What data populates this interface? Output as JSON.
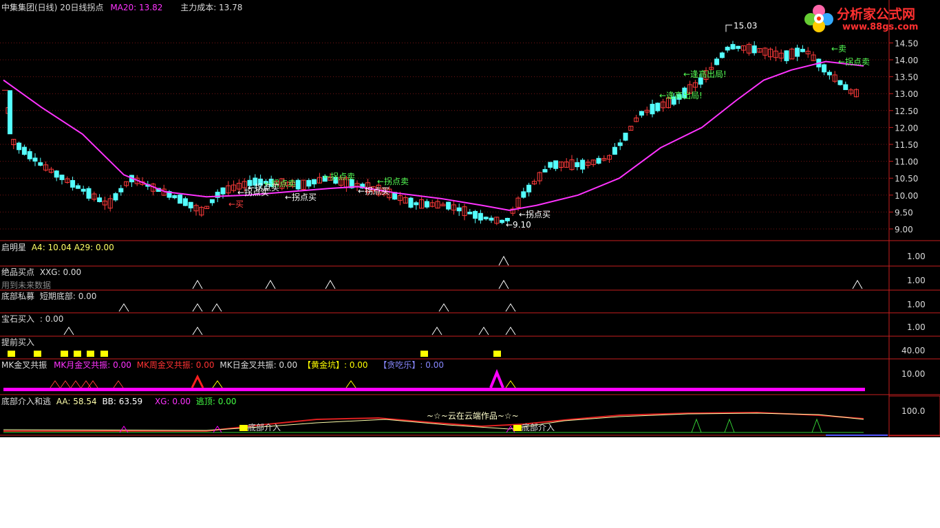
{
  "colors": {
    "bg": "#000000",
    "up": "#ff3b3b",
    "down": "#54ffff",
    "ma": "#ff33ff",
    "buy": "#ff4040",
    "sell": "#55ff55",
    "text": "#dcdcdc",
    "axis": "#c81e1e",
    "yellow": "#ffff00",
    "magenta": "#ff00ff",
    "green": "#33cc33"
  },
  "main": {
    "title": "中集集团(日线)",
    "indicator": "20日线拐点",
    "ma_label": "MA20: 13.82",
    "cost_label": "主力成本: 13.78",
    "yaxis": [
      "14.50",
      "14.00",
      "13.50",
      "13.00",
      "12.50",
      "12.00",
      "11.50",
      "11.00",
      "10.50",
      "10.00",
      "9.50",
      "9.00"
    ],
    "high_label": "15.03",
    "low_label": "9.10",
    "annotations": [
      {
        "text": "←卖",
        "type": "sell"
      },
      {
        "text": "←买",
        "type": "buy"
      },
      {
        "text": "←拐点卖",
        "type": "sell"
      },
      {
        "text": "←拐点买",
        "type": "text"
      },
      {
        "text": "←拐点卖",
        "type": "sell"
      },
      {
        "text": "←拐点买",
        "type": "text"
      },
      {
        "text": "←拐点买",
        "type": "text"
      },
      {
        "text": "←拐点卖",
        "type": "sell"
      },
      {
        "text": "←拐点买",
        "type": "text"
      },
      {
        "text": "←拐点卖",
        "type": "sell"
      },
      {
        "text": "←拐点买",
        "type": "text"
      },
      {
        "text": "←逢高出局!",
        "type": "sell"
      },
      {
        "text": "←逢高出局!",
        "type": "sell"
      },
      {
        "text": "←卖",
        "type": "sell"
      },
      {
        "text": "←拐点卖",
        "type": "sell"
      }
    ]
  },
  "logo": {
    "name": "分析家公式网",
    "url": "www.88gs.com"
  },
  "panels": {
    "qimingxing": {
      "name": "启明星",
      "values": "A4: 10.04  A29: 0.00",
      "axis": "1.00"
    },
    "juepin": {
      "name": "绝品买点",
      "values": "XXG: 0.00",
      "note": "用到未来数据",
      "axis": "1.00"
    },
    "dibu": {
      "name": "底部私募",
      "values": "短期底部: 0.00",
      "axis": "1.00"
    },
    "baoshi": {
      "name": "宝石买入",
      "values": ": 0.00",
      "axis": "1.00"
    },
    "tiqian": {
      "name": "提前买入",
      "axis": "40.00"
    },
    "mk": {
      "name": "MK金叉共振",
      "month": "MK月金叉共振: 0.00",
      "week": "MK周金叉共振: 0.00",
      "day": "MK日金叉共振: 0.00",
      "gold": "【黄金坑】: 0.00",
      "tan": "【贪吃乐】: 0.00",
      "axis": "10.00"
    },
    "bottom": {
      "name": "底部介入和逃",
      "aa": "AA: 58.54",
      "bb": "BB: 63.59",
      "xg": "XG: 0.00",
      "escape": "逃顶: 0.00",
      "axis": "100.0",
      "credit": "~☆~云在云端作品~☆~",
      "mark1": "底部介入",
      "mark2": "底部介入"
    }
  }
}
